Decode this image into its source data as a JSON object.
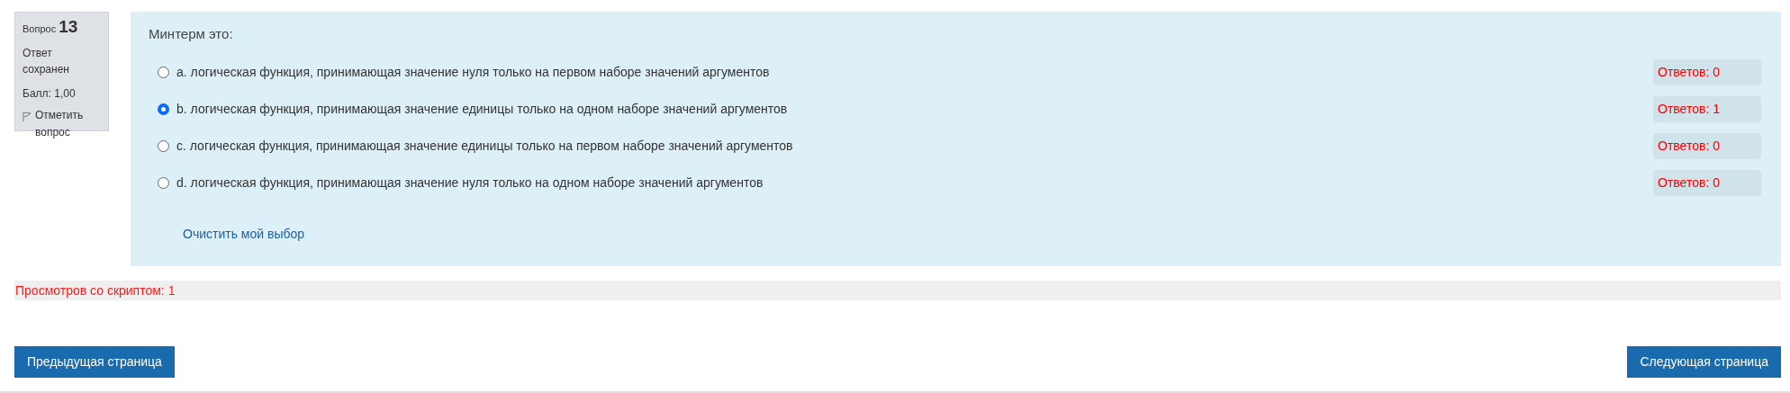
{
  "info": {
    "question_label": "Вопрос",
    "question_number": "13",
    "status": "Ответ сохранен",
    "score": "Балл: 1,00",
    "flag_label": "Отметить вопрос"
  },
  "question": {
    "text": "Минтерм это:",
    "options": [
      {
        "label": "a. логическая функция, принимающая значение нуля только на первом наборе значений аргументов",
        "selected": false,
        "count": "Ответов: 0"
      },
      {
        "label": "b. логическая функция, принимающая значение единицы только на одном наборе значений аргументов",
        "selected": true,
        "count": "Ответов: 1"
      },
      {
        "label": "c. логическая функция, принимающая значение единицы только на первом наборе значений аргументов",
        "selected": false,
        "count": "Ответов: 0"
      },
      {
        "label": "d. логическая функция, принимающая значение нуля только на одном наборе значений аргументов",
        "selected": false,
        "count": "Ответов: 0"
      }
    ],
    "clear_link": "Очистить мой выбор"
  },
  "script_views": "Просмотров со скриптом: 1",
  "buttons": {
    "previous": "Предыдущая страница",
    "next": "Следующая страница"
  }
}
